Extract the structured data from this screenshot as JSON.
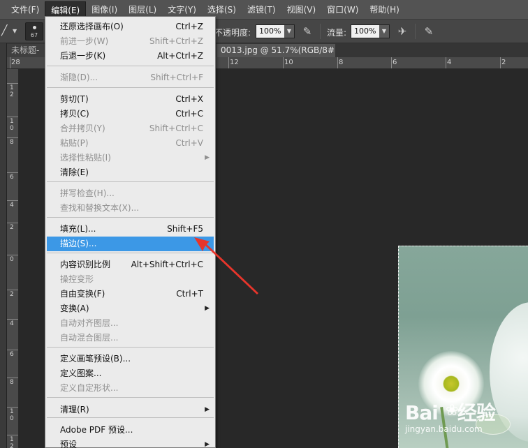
{
  "menubar": {
    "items": [
      "文件(F)",
      "编辑(E)",
      "图像(I)",
      "图层(L)",
      "文字(Y)",
      "选择(S)",
      "滤镜(T)",
      "视图(V)",
      "窗口(W)",
      "帮助(H)"
    ],
    "active_index": 1
  },
  "options_bar": {
    "brush_size": "67",
    "opacity_label": "不透明度:",
    "opacity_value": "100%",
    "flow_label": "流量:",
    "flow_value": "100%"
  },
  "tabs": {
    "tab1": "未标题-",
    "tab2": "0013.jpg @ 51.7%(RGB/8#)",
    "close_glyph": "×"
  },
  "ruler_top_labels": [
    "28",
    "12",
    "10",
    "8",
    "6",
    "4",
    "2",
    "0",
    "2",
    "4",
    "6",
    "8"
  ],
  "ruler_left_labels": [
    "1\n2",
    "1\n0",
    "8",
    "6",
    "4",
    "2",
    "0",
    "2",
    "4",
    "6",
    "8",
    "1\n0",
    "1\n2"
  ],
  "edit_menu": {
    "items": [
      {
        "label": "还原选择画布(O)",
        "shortcut": "Ctrl+Z",
        "state": "enabled"
      },
      {
        "label": "前进一步(W)",
        "shortcut": "Shift+Ctrl+Z",
        "state": "disabled"
      },
      {
        "label": "后退一步(K)",
        "shortcut": "Alt+Ctrl+Z",
        "state": "enabled"
      },
      {
        "label": "渐隐(D)...",
        "shortcut": "Shift+Ctrl+F",
        "state": "disabled"
      },
      {
        "label": "剪切(T)",
        "shortcut": "Ctrl+X",
        "state": "enabled"
      },
      {
        "label": "拷贝(C)",
        "shortcut": "Ctrl+C",
        "state": "enabled"
      },
      {
        "label": "合并拷贝(Y)",
        "shortcut": "Shift+Ctrl+C",
        "state": "disabled"
      },
      {
        "label": "粘贴(P)",
        "shortcut": "Ctrl+V",
        "state": "disabled"
      },
      {
        "label": "选择性粘贴(I)",
        "shortcut": "",
        "state": "disabled",
        "submenu": true
      },
      {
        "label": "清除(E)",
        "shortcut": "",
        "state": "enabled"
      },
      {
        "label": "拼写检查(H)...",
        "shortcut": "",
        "state": "disabled"
      },
      {
        "label": "查找和替换文本(X)...",
        "shortcut": "",
        "state": "disabled"
      },
      {
        "label": "填充(L)...",
        "shortcut": "Shift+F5",
        "state": "enabled"
      },
      {
        "label": "描边(S)...",
        "shortcut": "",
        "state": "highlighted"
      },
      {
        "label": "内容识别比例",
        "shortcut": "Alt+Shift+Ctrl+C",
        "state": "enabled"
      },
      {
        "label": "操控变形",
        "shortcut": "",
        "state": "disabled"
      },
      {
        "label": "自由变换(F)",
        "shortcut": "Ctrl+T",
        "state": "enabled"
      },
      {
        "label": "变换(A)",
        "shortcut": "",
        "state": "enabled",
        "submenu": true
      },
      {
        "label": "自动对齐图层...",
        "shortcut": "",
        "state": "disabled"
      },
      {
        "label": "自动混合图层...",
        "shortcut": "",
        "state": "disabled"
      },
      {
        "label": "定义画笔预设(B)...",
        "shortcut": "",
        "state": "enabled"
      },
      {
        "label": "定义图案...",
        "shortcut": "",
        "state": "enabled"
      },
      {
        "label": "定义自定形状...",
        "shortcut": "",
        "state": "disabled"
      },
      {
        "label": "清理(R)",
        "shortcut": "",
        "state": "enabled",
        "submenu": true
      },
      {
        "label": "Adobe PDF 预设...",
        "shortcut": "",
        "state": "enabled"
      },
      {
        "label": "预设",
        "shortcut": "",
        "state": "enabled",
        "submenu": true
      }
    ],
    "submenu_glyph": "▶"
  },
  "watermark": {
    "brand_left": "Bai",
    "brand_right": "经验",
    "url": "jingyan.baidu.com"
  },
  "annotation_color": "#e8352b",
  "highlight_color": "#3c98e6"
}
